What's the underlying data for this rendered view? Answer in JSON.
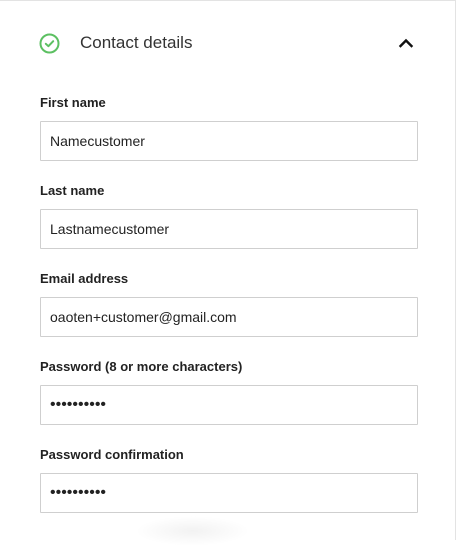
{
  "section": {
    "title": "Contact details",
    "status_icon": "check-circle-icon",
    "toggle_icon": "chevron-up-icon",
    "accent_color": "#5cc062"
  },
  "fields": {
    "first_name": {
      "label": "First name",
      "value": "Namecustomer"
    },
    "last_name": {
      "label": "Last name",
      "value": "Lastnamecustomer"
    },
    "email": {
      "label": "Email address",
      "value": "oaoten+customer@gmail.com"
    },
    "password": {
      "label": "Password (8 or more characters)",
      "value": "••••••••••"
    },
    "password_confirmation": {
      "label": "Password confirmation",
      "value": "••••••••••"
    }
  }
}
